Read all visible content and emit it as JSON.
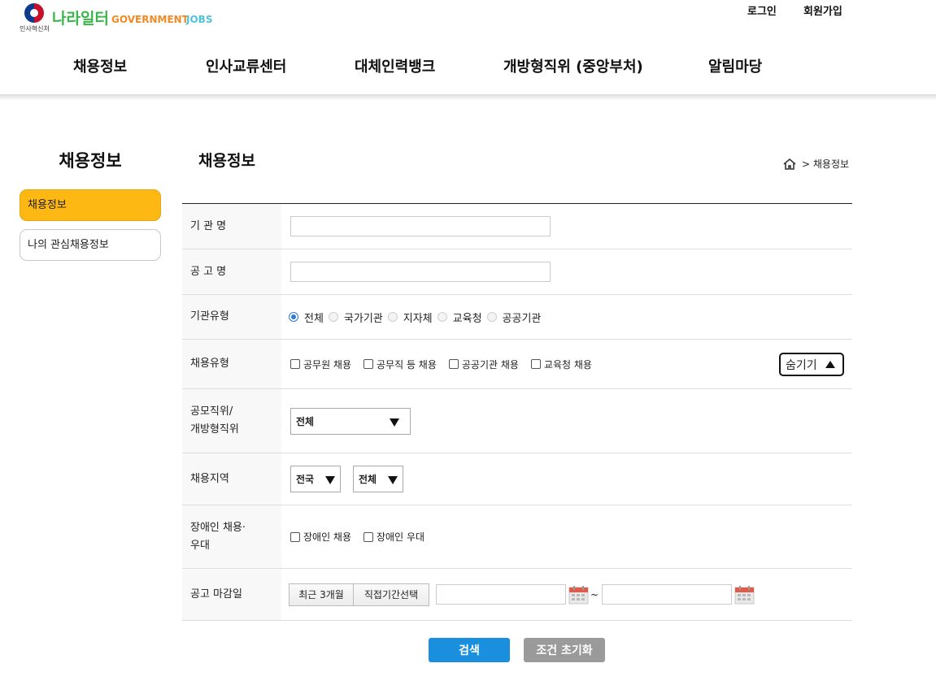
{
  "header": {
    "ministry": "인사혁신처",
    "brand_kr": "나라일터",
    "brand_en_1": "GOVERNMENT",
    "brand_en_2": "JOBS",
    "login": "로그인",
    "signup": "회원가입",
    "nav": [
      "채용정보",
      "인사교류센터",
      "대체인력뱅크",
      "개방형직위 (중앙부처)",
      "알림마당"
    ]
  },
  "sidebar": {
    "title": "채용정보",
    "items": [
      {
        "label": "채용정보",
        "active": true
      },
      {
        "label": "나의 관심채용정보",
        "active": false
      }
    ]
  },
  "content": {
    "title": "채용정보",
    "breadcrumb": "> 채용정보"
  },
  "form": {
    "agency_name": {
      "label": "기 관 명",
      "value": ""
    },
    "notice_name": {
      "label": "공 고 명",
      "value": ""
    },
    "agency_type": {
      "label": "기관유형",
      "options": [
        "전체",
        "국가기관",
        "지자체",
        "교육청",
        "공공기관"
      ],
      "selected": "전체"
    },
    "hire_type": {
      "label": "채용유형",
      "options": [
        "공무원 채용",
        "공무직 등 채용",
        "공공기관 채용",
        "교육청 채용"
      ],
      "toggle_label": "숨기기"
    },
    "position": {
      "label_1": "공모직위/",
      "label_2": "개방형직위",
      "selected": "전체"
    },
    "region": {
      "label": "채용지역",
      "selected_1": "전국",
      "selected_2": "전체"
    },
    "disabled": {
      "label_1": "장애인 채용·",
      "label_2": "우대",
      "options": [
        "장애인 채용",
        "장애인 우대"
      ]
    },
    "deadline": {
      "label": "공고 마감일",
      "btn_recent": "최근 3개월",
      "btn_custom": "직접기간선택",
      "tilde": "~"
    }
  },
  "actions": {
    "search": "검색",
    "reset": "조건 초기화"
  },
  "colors": {
    "active_menu": "#fdb813",
    "search_button": "#1a8fde",
    "reset_button": "#9a9a9a",
    "brand_green": "#3ab54a"
  }
}
